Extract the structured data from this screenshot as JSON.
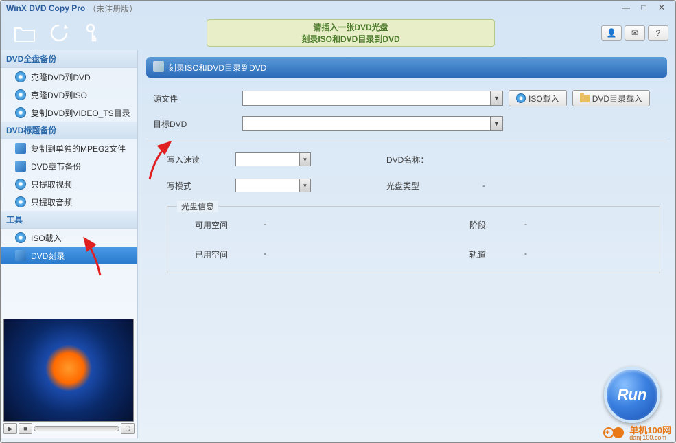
{
  "title": {
    "app": "WinX DVD Copy Pro",
    "suffix": "（未注册版）"
  },
  "winbtns": {
    "min": "—",
    "max": "□",
    "close": "✕"
  },
  "notice": {
    "line1": "请插入一张DVD光盘",
    "line2": "刻录ISO和DVD目录到DVD"
  },
  "helpbtns": {
    "user": "👤",
    "mail": "✉",
    "help": "?"
  },
  "sidebar": {
    "group1": "DVD全盘备份",
    "items1": [
      {
        "label": "克隆DVD到DVD"
      },
      {
        "label": "克隆DVD到ISO"
      },
      {
        "label": "复制DVD到VIDEO_TS目录"
      }
    ],
    "group2": "DVD标题备份",
    "items2": [
      {
        "label": "复制到单独的MPEG2文件"
      },
      {
        "label": "DVD章节备份"
      },
      {
        "label": "只提取视频"
      },
      {
        "label": "只提取音频"
      }
    ],
    "group3": "工具",
    "items3": [
      {
        "label": "ISO载入"
      },
      {
        "label": "DVD刻录"
      }
    ]
  },
  "section": {
    "title": "刻录ISO和DVD目录到DVD"
  },
  "form": {
    "source_label": "源文件",
    "btn_iso": "ISO载入",
    "btn_dir": "DVD目录载入",
    "target_label": "目标DVD",
    "speed_label": "写入速读",
    "name_label": "DVD名称：",
    "mode_label": "写模式",
    "type_label": "光盘类型",
    "dash": "-"
  },
  "disc": {
    "legend": "光盘信息",
    "avail": "可用空间",
    "stage": "阶段",
    "used": "已用空间",
    "track": "轨道",
    "dash": "-"
  },
  "run": "Run",
  "watermark": {
    "text": "单机100网",
    "url": "danji100.com"
  }
}
